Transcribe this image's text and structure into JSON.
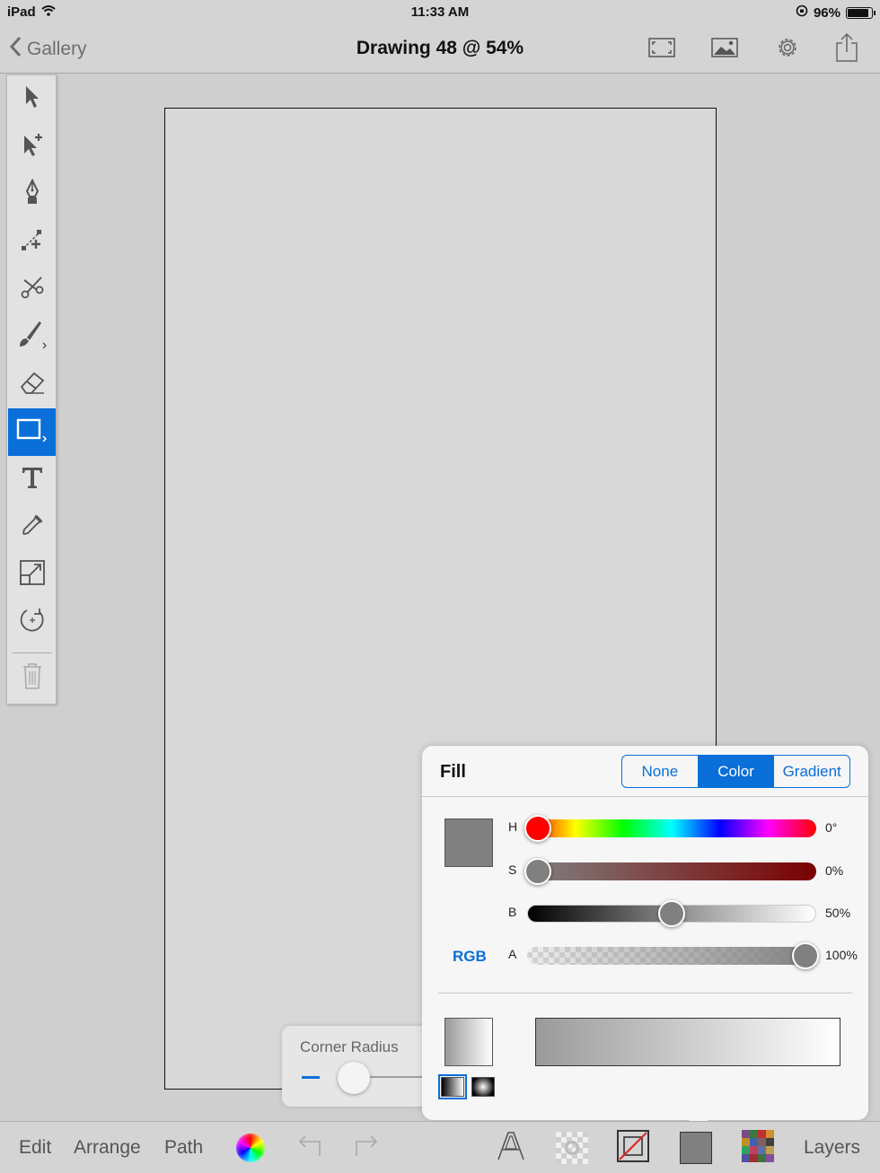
{
  "status_bar": {
    "device": "iPad",
    "time": "11:33 AM",
    "battery_percent": "96%",
    "battery_level": 0.96
  },
  "nav": {
    "back_label": "Gallery",
    "title": "Drawing 48 @ 54%",
    "icons": [
      "fit-screen-icon",
      "image-icon",
      "gear-icon",
      "share-icon"
    ]
  },
  "tools": [
    {
      "name": "select-tool",
      "icon": "arrow-icon"
    },
    {
      "name": "direct-select-tool",
      "icon": "arrow-plus-icon"
    },
    {
      "name": "pen-tool",
      "icon": "pen-nib-icon"
    },
    {
      "name": "add-point-tool",
      "icon": "node-plus-icon"
    },
    {
      "name": "scissors-tool",
      "icon": "scissors-icon"
    },
    {
      "name": "brush-tool",
      "icon": "brush-icon"
    },
    {
      "name": "eraser-tool",
      "icon": "eraser-icon"
    },
    {
      "name": "rectangle-tool",
      "icon": "rectangle-icon",
      "active": true
    },
    {
      "name": "text-tool",
      "icon": "text-t-icon"
    },
    {
      "name": "eyedropper-tool",
      "icon": "eyedropper-icon"
    },
    {
      "name": "scale-tool",
      "icon": "scale-icon"
    },
    {
      "name": "rotate-tool",
      "icon": "rotate-icon"
    },
    {
      "name": "delete-tool",
      "icon": "trash-icon"
    }
  ],
  "corner_radius": {
    "label": "Corner Radius",
    "value": 0
  },
  "fill": {
    "title": "Fill",
    "modes": [
      "None",
      "Color",
      "Gradient"
    ],
    "selected_mode": "Color",
    "current_color": "#808080",
    "rgb_link": "RGB",
    "sliders": [
      {
        "label": "H",
        "value": "0°",
        "fraction": 0.0,
        "thumb_color": "#ff0000"
      },
      {
        "label": "S",
        "value": "0%",
        "fraction": 0.0,
        "thumb_color": "#808080"
      },
      {
        "label": "B",
        "value": "50%",
        "fraction": 0.5,
        "thumb_color": "#808080"
      },
      {
        "label": "A",
        "value": "100%",
        "fraction": 1.0,
        "thumb_color": "#808080"
      }
    ]
  },
  "bottom_bar": {
    "edit": "Edit",
    "arrange": "Arrange",
    "path": "Path",
    "layers": "Layers"
  },
  "colors": {
    "accent": "#0a6fd8",
    "fill_gray": "#808080"
  }
}
